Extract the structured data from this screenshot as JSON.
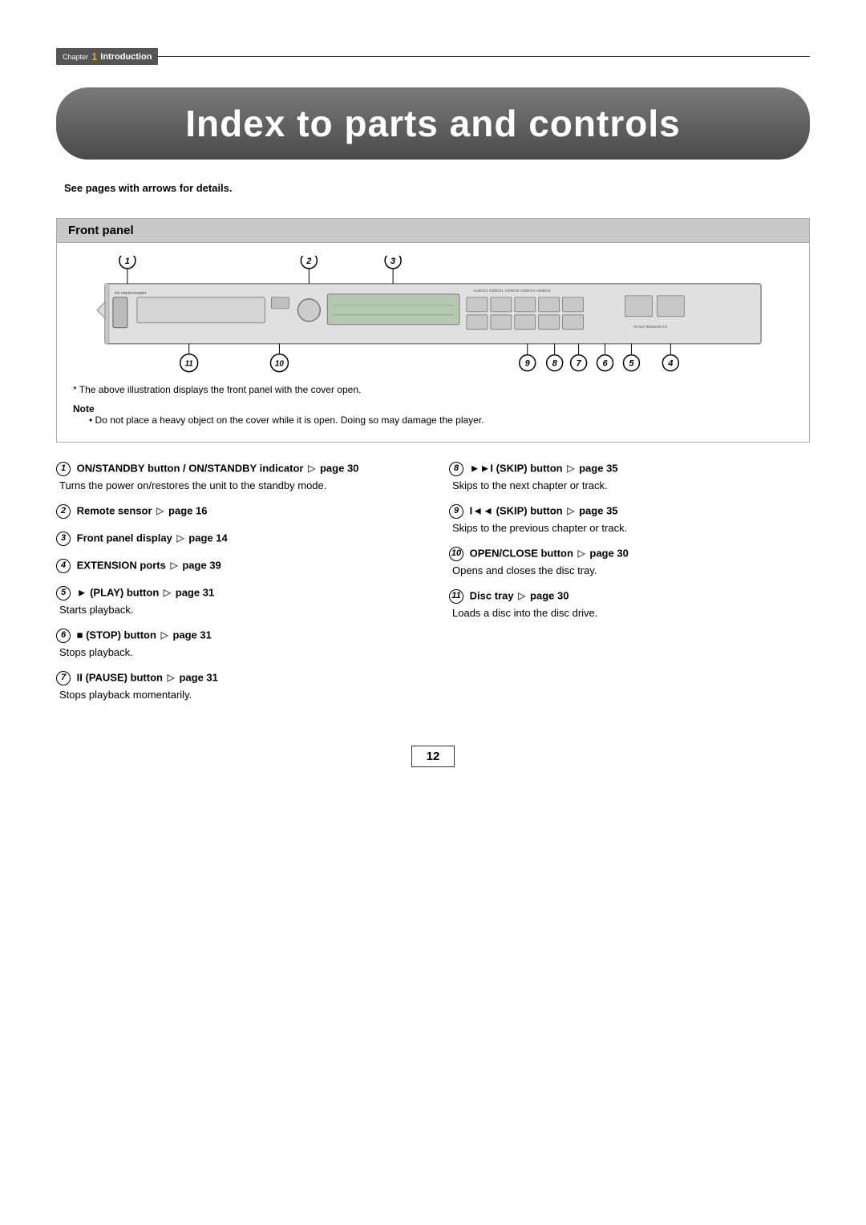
{
  "chapter": {
    "word": "Chapter",
    "number": "1",
    "title": "Introduction"
  },
  "page_title": "Index to parts and controls",
  "see_pages_note": "See pages with arrows for details.",
  "front_panel": {
    "header": "Front panel",
    "footnote_asterisk": "* The above illustration displays the front panel with the cover open.",
    "note_label": "Note",
    "note_bullet": "Do not place a heavy object on the cover while it is open. Doing so may damage the player."
  },
  "items": [
    {
      "num": "1",
      "title": "ON/STANDBY button / ON/STANDBY indicator",
      "arrow": "▷",
      "page_label": "page",
      "page": "30",
      "description": "Turns the power on/restores the unit to the standby mode."
    },
    {
      "num": "2",
      "title": "Remote sensor",
      "arrow": "▷",
      "page_label": "page",
      "page": "16",
      "description": ""
    },
    {
      "num": "3",
      "title": "Front panel display",
      "arrow": "▷",
      "page_label": "page",
      "page": "14",
      "description": ""
    },
    {
      "num": "4",
      "title": "EXTENSION ports",
      "arrow": "▷",
      "page_label": "page",
      "page": "39",
      "description": ""
    },
    {
      "num": "5",
      "title": "► (PLAY) button",
      "arrow": "▷",
      "page_label": "page",
      "page": "31",
      "description": "Starts playback."
    },
    {
      "num": "6",
      "title": "■ (STOP) button",
      "arrow": "▷",
      "page_label": "page",
      "page": "31",
      "description": "Stops playback."
    },
    {
      "num": "7",
      "title": "II (PAUSE) button",
      "arrow": "▷",
      "page_label": "page",
      "page": "31",
      "description": "Stops playback momentarily."
    },
    {
      "num": "8",
      "title": "►►I (SKIP) button",
      "arrow": "▷",
      "page_label": "page",
      "page": "35",
      "description": "Skips to the next chapter or track."
    },
    {
      "num": "9",
      "title": "I◄◄ (SKIP) button",
      "arrow": "▷",
      "page_label": "page",
      "page": "35",
      "description": "Skips to the previous chapter or track."
    },
    {
      "num": "10",
      "title": "OPEN/CLOSE button",
      "arrow": "▷",
      "page_label": "page",
      "page": "30",
      "description": "Opens and closes the disc tray."
    },
    {
      "num": "11",
      "title": "Disc tray",
      "arrow": "▷",
      "page_label": "page",
      "page": "30",
      "description": "Loads a disc into the disc drive."
    }
  ],
  "page_number": "12"
}
